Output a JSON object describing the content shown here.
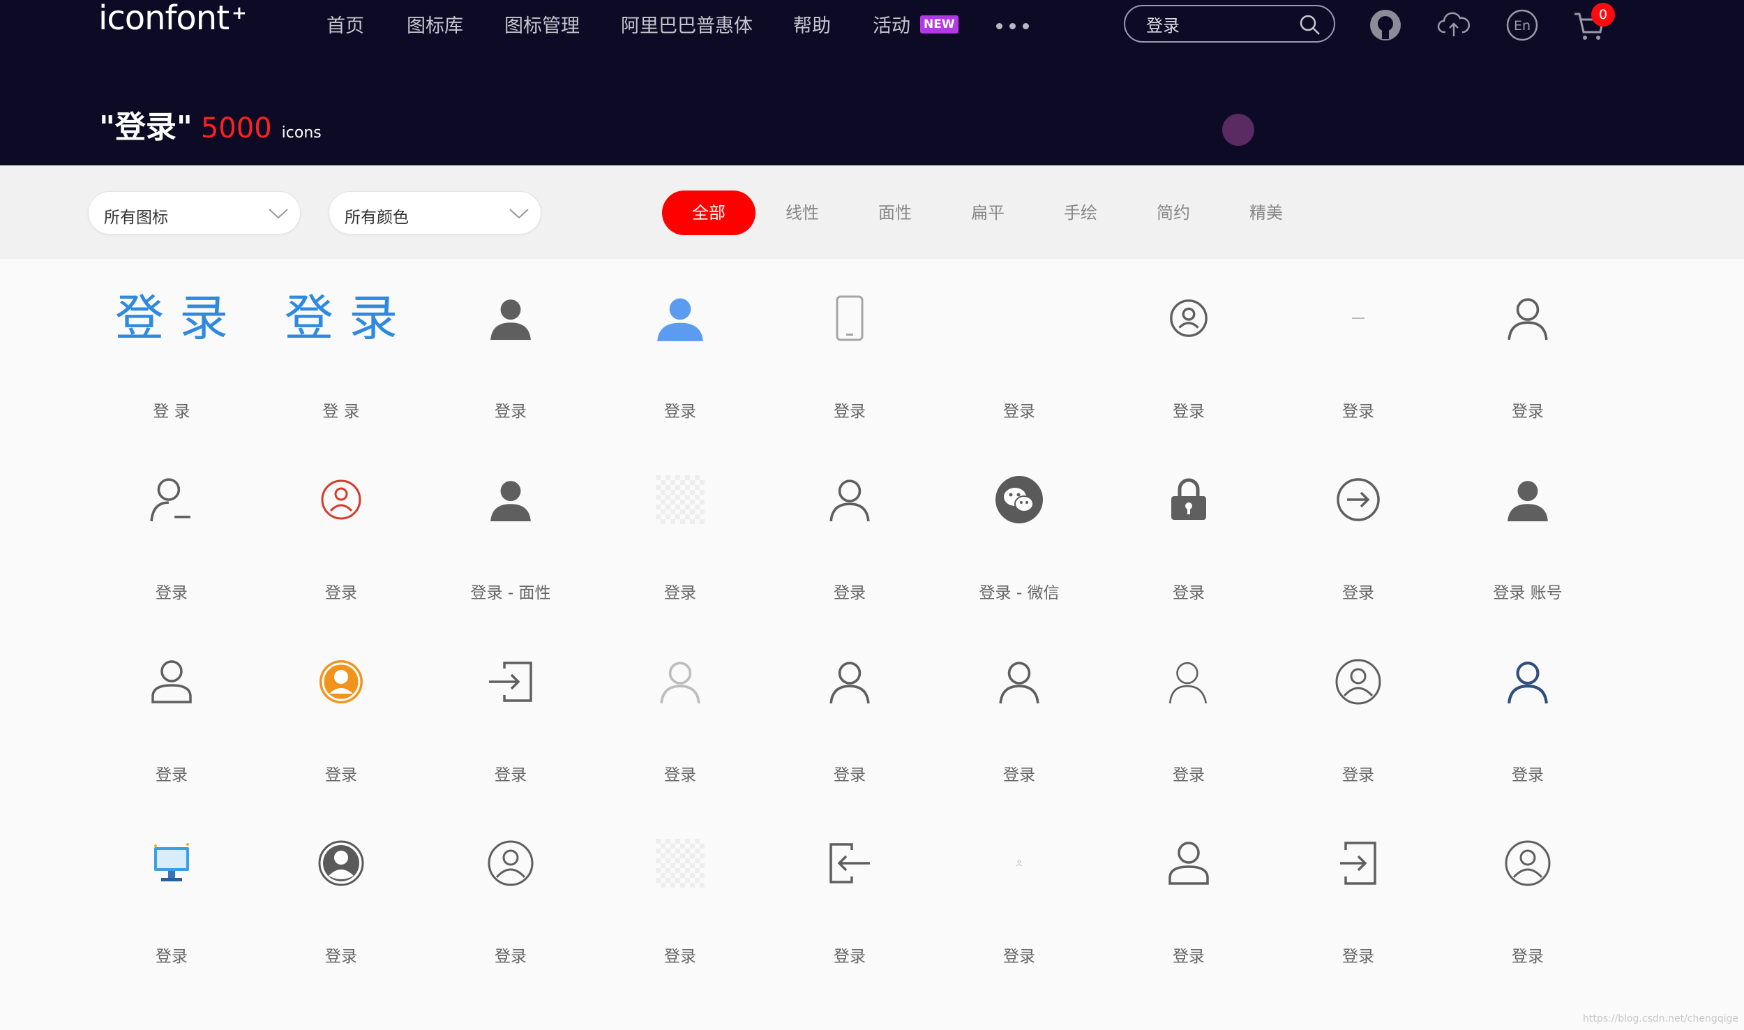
{
  "header": {
    "logo": "iconfont",
    "logo_plus": "+",
    "nav": [
      "首页",
      "图标库",
      "图标管理",
      "阿里巴巴普惠体",
      "帮助",
      "活动"
    ],
    "new_tag": "NEW",
    "search_value": "登录",
    "cart_count": "0",
    "lang_icon_text": "En",
    "colors": {
      "bg": "#0c0a24",
      "accent": "#ff0000",
      "new_tag": "#b33ae2"
    }
  },
  "result": {
    "query": "\"登录\"",
    "count": "5000",
    "unit": "icons"
  },
  "filters": {
    "type_select": "所有图标",
    "color_select": "所有颜色",
    "tabs": [
      "全部",
      "线性",
      "面性",
      "扁平",
      "手绘",
      "简约",
      "精美"
    ],
    "active_tab": "全部"
  },
  "icons": [
    {
      "label": "登 录",
      "icon": "text-denglu-blue-icon"
    },
    {
      "label": "登 录",
      "icon": "text-denglu-blue-icon"
    },
    {
      "label": "登录",
      "icon": "user-filled-icon"
    },
    {
      "label": "登录",
      "icon": "user-filled-blue-icon"
    },
    {
      "label": "登录",
      "icon": "phone-icon"
    },
    {
      "label": "登录",
      "icon": "blank-icon"
    },
    {
      "label": "登录",
      "icon": "user-circle-icon"
    },
    {
      "label": "登录",
      "icon": "tiny-text-icon"
    },
    {
      "label": "登录",
      "icon": "user-outline-icon"
    },
    {
      "label": "登录",
      "icon": "user-minus-icon"
    },
    {
      "label": "登录",
      "icon": "user-circle-red-icon"
    },
    {
      "label": "登录 - 面性",
      "icon": "user-filled-icon"
    },
    {
      "label": "登录",
      "icon": "transparent-placeholder-icon"
    },
    {
      "label": "登录",
      "icon": "user-outline-icon"
    },
    {
      "label": "登录 - 微信",
      "icon": "wechat-icon"
    },
    {
      "label": "登录",
      "icon": "lock-icon"
    },
    {
      "label": "登录",
      "icon": "arrow-circle-right-icon"
    },
    {
      "label": "登录 账号",
      "icon": "user-filled-icon"
    },
    {
      "label": "登录",
      "icon": "user-rounded-icon"
    },
    {
      "label": "登录",
      "icon": "user-circle-orange-icon"
    },
    {
      "label": "登录",
      "icon": "login-arrow-icon"
    },
    {
      "label": "登录",
      "icon": "user-outline-light-icon"
    },
    {
      "label": "登录",
      "icon": "user-outline-icon"
    },
    {
      "label": "登录",
      "icon": "user-outline-icon"
    },
    {
      "label": "登录",
      "icon": "user-outline-thin-icon"
    },
    {
      "label": "登录",
      "icon": "user-circle-outline-icon"
    },
    {
      "label": "登录",
      "icon": "user-outline-navy-icon"
    },
    {
      "label": "登录",
      "icon": "computer-color-icon"
    },
    {
      "label": "登录",
      "icon": "user-circle-filled-icon"
    },
    {
      "label": "登录",
      "icon": "user-circle-outline-icon"
    },
    {
      "label": "登录",
      "icon": "transparent-placeholder-icon"
    },
    {
      "label": "登录",
      "icon": "logout-arrow-icon"
    },
    {
      "label": "登录",
      "icon": "tiny-user-icon"
    },
    {
      "label": "登录",
      "icon": "user-rounded-icon"
    },
    {
      "label": "登录",
      "icon": "login-door-icon"
    },
    {
      "label": "登录",
      "icon": "user-circle-outline-icon"
    }
  ],
  "watermark": "https://blog.csdn.net/chengqige"
}
